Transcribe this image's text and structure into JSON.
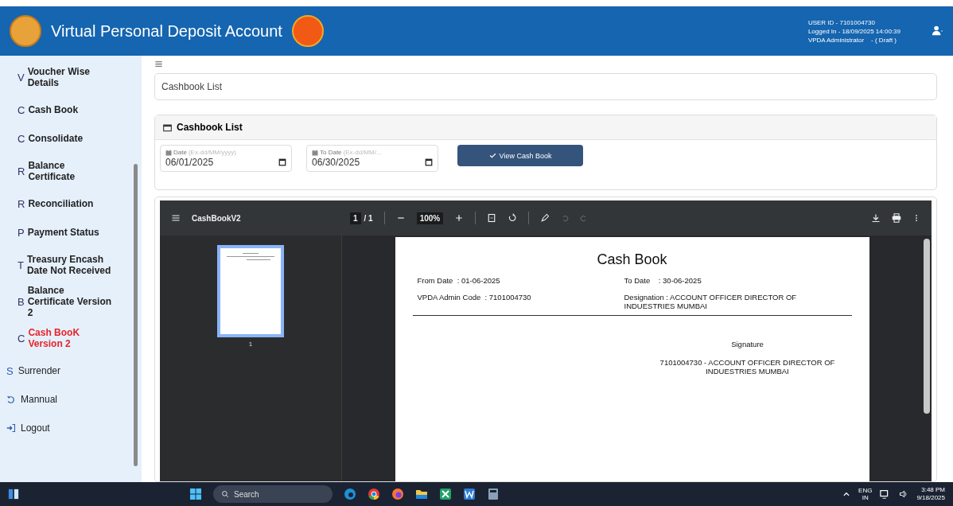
{
  "header": {
    "title": "Virtual Personal Deposit Account",
    "user_info": [
      "USER ID - 7101004730",
      "Logged In - 18/09/2025 14:00:39",
      "VPDA Administrator    - ( Draft )"
    ]
  },
  "sidebar": {
    "submenu_items": [
      {
        "letter": "V",
        "label": "Voucher Wise Details",
        "selected": false
      },
      {
        "letter": "C",
        "label": "Cash Book",
        "selected": false
      },
      {
        "letter": "C",
        "label": "Consolidate",
        "selected": false
      },
      {
        "letter": "R",
        "label": "Balance Certificate",
        "selected": false
      },
      {
        "letter": "R",
        "label": "Reconciliation",
        "selected": false
      },
      {
        "letter": "P",
        "label": "Payment Status",
        "selected": false
      },
      {
        "letter": "T",
        "label": "Treasury Encash Date Not Received",
        "selected": false
      },
      {
        "letter": "B",
        "label": "Balance Certificate Version 2",
        "selected": false
      },
      {
        "letter": "C",
        "label": "Cash BooK Version 2",
        "selected": true
      }
    ],
    "menu_items": [
      {
        "kind": "letter",
        "letter": "S",
        "label": "Surrender"
      },
      {
        "kind": "manual",
        "label": "Mannual"
      },
      {
        "kind": "logout",
        "label": "Logout"
      }
    ]
  },
  "breadcrumb": "Cashbook List",
  "card": {
    "title": "Cashbook List",
    "fields": [
      {
        "label": "Date",
        "hint": "(Ex-dd/MM/yyyy)",
        "value": "06/01/2025"
      },
      {
        "label": "To Date",
        "hint": "(Ex-dd/MM/...",
        "value": "06/30/2025"
      }
    ],
    "button": "View Cash Book"
  },
  "viewer": {
    "title": "CashBookV2",
    "page": "1",
    "total": "/ 1",
    "zoom": "100%",
    "thumbnail_label": "1",
    "document": {
      "title": "Cash Book",
      "from_date": "From Date  : 01-06-2025",
      "to_date": "To Date    : 30-06-2025",
      "admin_code": "VPDA Admin Code  : 7101004730",
      "designation": "Designation : ACCOUNT OFFICER  DIRECTOR OF INDUESTRIES MUMBAI",
      "signature": "Signature",
      "signatory": "7101004730 - ACCOUNT OFFICER  DIRECTOR OF INDUESTRIES MUMBAI"
    }
  },
  "taskbar": {
    "search": "Search",
    "language": "ENG",
    "region": "IN",
    "time": "3:48 PM",
    "date": "9/18/2025"
  }
}
